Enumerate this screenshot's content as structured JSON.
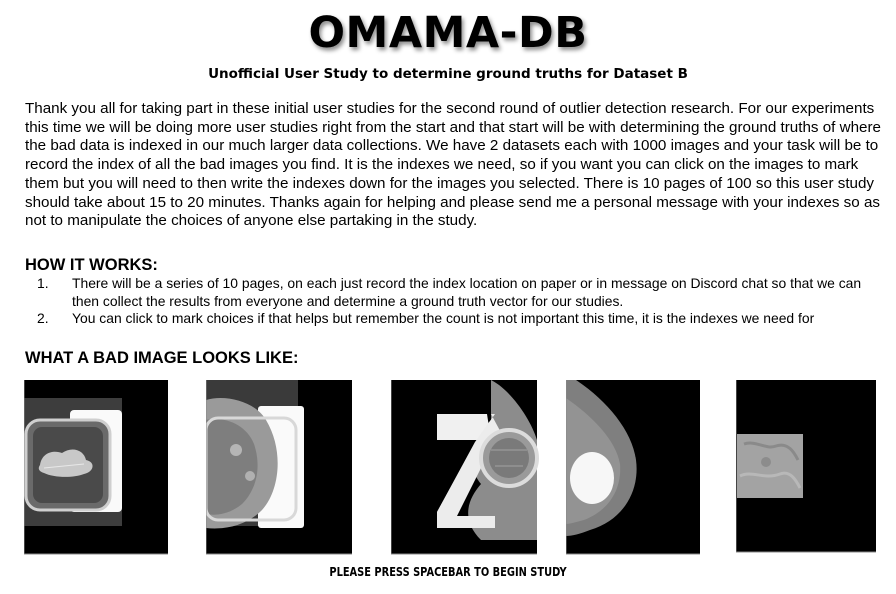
{
  "header": {
    "title": "OMAMA-DB",
    "subtitle": "Unofficial User Study to determine ground truths for Dataset B"
  },
  "intro": "Thank you all for taking part in these initial user studies for the second round of outlier detection research. For our experiments this time we will be doing more user studies right from the start and that start will be with determining the ground truths of where the bad data is indexed in our much larger data collections. We have 2 datasets each with 1000 images and your task will be to record the index of all the bad images you find. It is the indexes we need, so if you want you can click on the images to mark them but you will need to then write the indexes down for the images you selected. There is 10 pages of 100 so this user study should take about 15 to 20 minutes. Thanks again for helping and please send me a personal message with your indexes so as not to manipulate the choices of anyone else partaking in the study.",
  "how_it_works": {
    "heading": "HOW IT WORKS:",
    "steps": [
      {
        "number": "1.",
        "text": "There will be a series of 10 pages, on each just record the index location on paper or in message on Discord chat so that we can then collect the results from everyone and determine a ground truth vector for our studies."
      },
      {
        "number": "2.",
        "text": "You can click to mark choices if that helps but remember the count is not important this time, it is the indexes we need for"
      }
    ]
  },
  "examples": {
    "heading": "WHAT A BAD IMAGE LOOKS LIKE:",
    "images": [
      {
        "name": "bad-example-image-1",
        "description": "scan with rectangular paddle artifact and dark background"
      },
      {
        "name": "bad-example-image-2",
        "description": "breast scan with frame overlay"
      },
      {
        "name": "bad-example-image-3",
        "description": "breast scan with diagonal compression paddle"
      },
      {
        "name": "bad-example-image-4",
        "description": "breast scan with bright circular implant"
      },
      {
        "name": "bad-example-image-5",
        "description": "small gray tissue patch on black background"
      }
    ]
  },
  "footer": {
    "start_hint": "PLEASE PRESS SPACEBAR TO BEGIN STUDY"
  }
}
